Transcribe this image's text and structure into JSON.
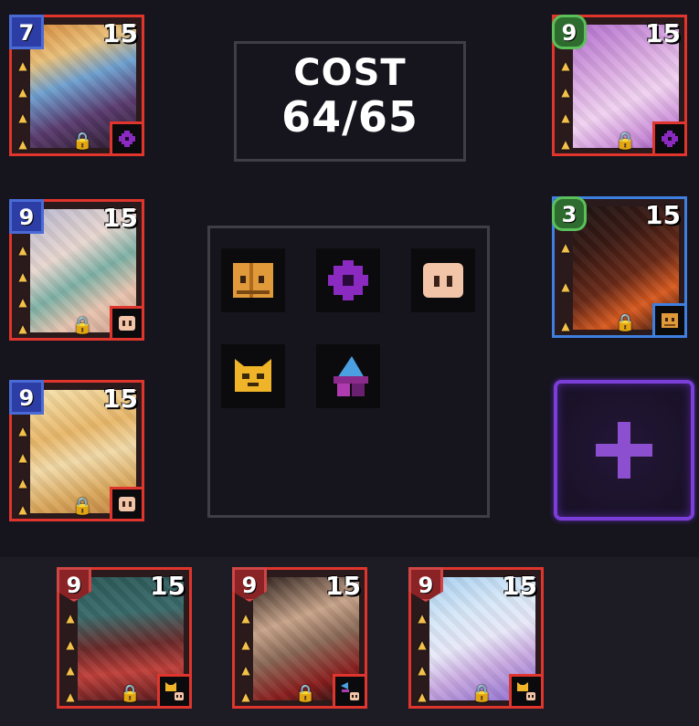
{
  "cost": {
    "title": "COST",
    "value": "64/65"
  },
  "units": [
    {
      "slot": "left-1",
      "level": "7",
      "cost": "15",
      "frame": "red",
      "badge": "blue",
      "trait_icon": "purple-gear-icon",
      "colors": [
        "#5a3b6e",
        "#d88a3c",
        "#6ea0d0"
      ]
    },
    {
      "slot": "left-2",
      "level": "9",
      "cost": "15",
      "frame": "red",
      "badge": "blue",
      "trait_icon": "peach-face-icon",
      "colors": [
        "#e8d7d0",
        "#b8b8d0",
        "#7fb1a6"
      ]
    },
    {
      "slot": "left-3",
      "level": "9",
      "cost": "15",
      "frame": "red",
      "badge": "blue",
      "trait_icon": "peach-face-icon",
      "colors": [
        "#f1d9a8",
        "#d9a65a",
        "#e8b76a"
      ]
    },
    {
      "slot": "right-1",
      "level": "9",
      "cost": "15",
      "frame": "red",
      "badge": "green",
      "trait_icon": "purple-gear-icon",
      "colors": [
        "#d8a7e0",
        "#b36fcf",
        "#f0d2f0"
      ]
    },
    {
      "slot": "right-2",
      "level": "3",
      "cost": "15",
      "frame": "blue",
      "badge": "green",
      "trait_icon": "orange-mask-icon",
      "colors": [
        "#1e1414",
        "#6a2a18",
        "#d85a20"
      ]
    },
    {
      "slot": "bottom-1",
      "level": "9",
      "cost": "15",
      "frame": "red",
      "badge": "red",
      "trait_icon": "cat-skull-icon",
      "colors": [
        "#2d5a5a",
        "#c0403a",
        "#6b2a2a"
      ]
    },
    {
      "slot": "bottom-2",
      "level": "9",
      "cost": "15",
      "frame": "red",
      "badge": "red",
      "trait_icon": "wing-skull-icon",
      "colors": [
        "#3a2a24",
        "#c8a48a",
        "#8a1e1e"
      ]
    },
    {
      "slot": "bottom-3",
      "level": "9",
      "cost": "15",
      "frame": "red",
      "badge": "red",
      "trait_icon": "cat-skull-icon",
      "colors": [
        "#a8d0f0",
        "#e8e8f8",
        "#8a6ad0"
      ]
    }
  ],
  "synergies": [
    {
      "name": "orange-mask-icon",
      "color": "#e09a3a"
    },
    {
      "name": "purple-gear-icon",
      "color": "#8a2ac0"
    },
    {
      "name": "peach-face-icon",
      "color": "#f2c4a8"
    },
    {
      "name": "yellow-cat-icon",
      "color": "#f0b429"
    },
    {
      "name": "witch-hat-icon",
      "color": "#4aa0e0"
    }
  ]
}
